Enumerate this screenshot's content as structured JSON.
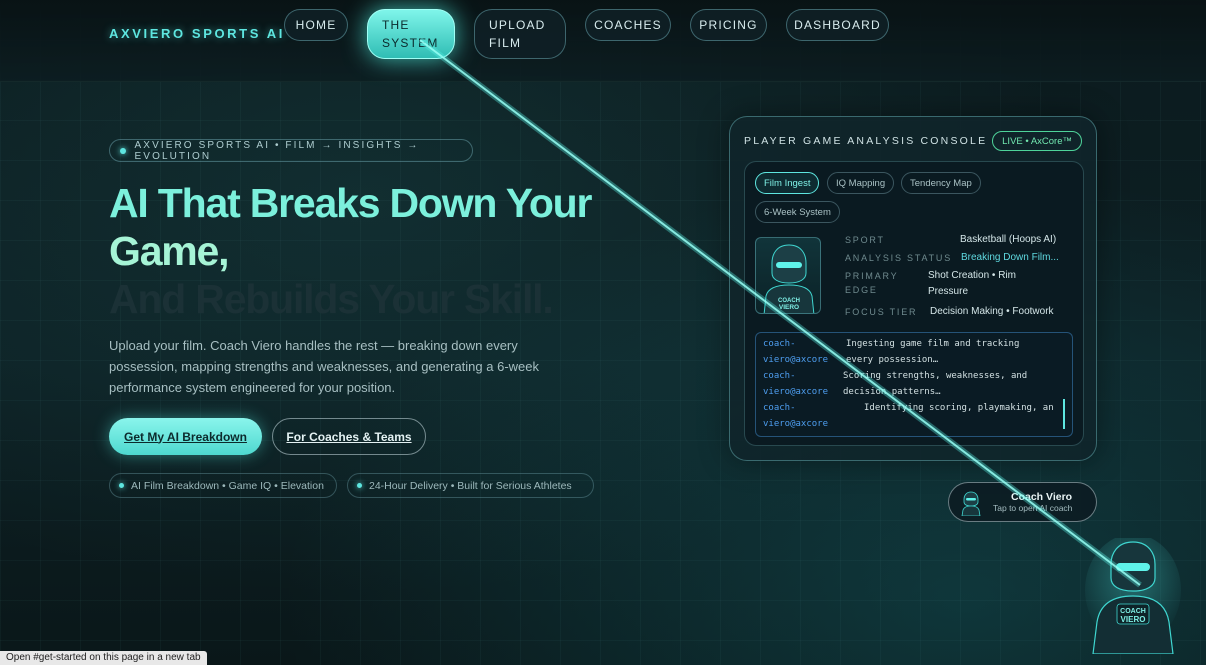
{
  "brand": "AXVIERO SPORTS AI",
  "nav": {
    "home": "HOME",
    "system": "THE\nSYSTEM",
    "upload": "UPLOAD\nFILM",
    "coaches": "COACHES",
    "pricing": "PRICING",
    "dashboard": "DASHBOARD"
  },
  "hero": {
    "eyebrow": "AXVIERO SPORTS AI • FILM → INSIGHTS → EVOLUTION",
    "headline_1": "AI That Breaks Down Your",
    "headline_2": "Game,",
    "headline_3": "And Rebuilds Your Skill.",
    "lede": "Upload your film. Coach Viero handles the rest — breaking down every possession, mapping strengths and weaknesses, and generating a 6-week performance system engineered for your position.",
    "cta_primary": "Get My AI Breakdown",
    "cta_secondary": "For Coaches & Teams",
    "chips": [
      "AI Film Breakdown • Game IQ • Elevation",
      "24-Hour Delivery • Built for Serious Athletes"
    ]
  },
  "console": {
    "title": "PLAYER GAME ANALYSIS CONSOLE",
    "live_badge": "LIVE • AxCore™",
    "tabs": [
      "Film Ingest",
      "IQ Mapping",
      "Tendency Map",
      "6-Week System"
    ],
    "avatar_label": "COACH\nVIERO",
    "fields": {
      "sport_k": "SPORT",
      "sport_v": "Basketball (Hoops AI)",
      "status_k": "ANALYSIS STATUS",
      "status_v": "Breaking Down Film...",
      "edge_k": "PRIMARY\nEDGE",
      "edge_v": "Shot Creation • Rim\nPressure",
      "focus_k": "FOCUS TIER",
      "focus_v": "Decision Making • Footwork"
    },
    "terminal": {
      "user": "coach-\nviero@axcore",
      "line1": "Ingesting game film and tracking\nevery possession…",
      "line2": "Scoring strengths, weaknesses, and\ndecision patterns…",
      "line3": "Identifying scoring, playmaking, an"
    }
  },
  "coach_widget": {
    "name": "Coach Viero",
    "subtitle": "Tap to open AI coach",
    "fab_label": "COACH\nVIERO"
  },
  "status_bar": "Open #get-started on this page in a new tab",
  "colors": {
    "accent": "#5ee6e0",
    "live": "#4ed39a",
    "background": "#0b1a1d"
  }
}
